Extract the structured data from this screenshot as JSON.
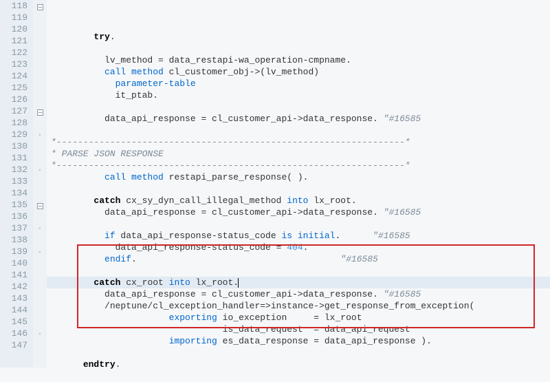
{
  "lines": [
    {
      "num": 118,
      "fold": "minus",
      "tokens": [
        [
          "sp",
          "        "
        ],
        [
          "kwbold",
          "try"
        ],
        [
          "ident",
          "."
        ]
      ]
    },
    {
      "num": 119,
      "tokens": []
    },
    {
      "num": 120,
      "tokens": [
        [
          "sp",
          "          "
        ],
        [
          "ident",
          "lv_method = data_restapi-wa_operation-cmpname."
        ]
      ]
    },
    {
      "num": 121,
      "tokens": [
        [
          "sp",
          "          "
        ],
        [
          "kw",
          "call method"
        ],
        [
          "ident",
          " cl_customer_obj->(lv_method)"
        ]
      ]
    },
    {
      "num": 122,
      "tokens": [
        [
          "sp",
          "            "
        ],
        [
          "kw",
          "parameter-table"
        ]
      ]
    },
    {
      "num": 123,
      "tokens": [
        [
          "sp",
          "            "
        ],
        [
          "ident",
          "it_ptab."
        ]
      ]
    },
    {
      "num": 124,
      "tokens": []
    },
    {
      "num": 125,
      "tokens": [
        [
          "sp",
          "          "
        ],
        [
          "ident",
          "data_api_response = cl_customer_api->data_response. "
        ],
        [
          "comment",
          "\"#16585"
        ]
      ]
    },
    {
      "num": 126,
      "tokens": []
    },
    {
      "num": 127,
      "fold": "minus",
      "tokens": [
        [
          "comment",
          "*-----------------------------------------------------------------*"
        ]
      ]
    },
    {
      "num": 128,
      "tokens": [
        [
          "comment",
          "* PARSE JSON RESPONSE"
        ]
      ]
    },
    {
      "num": 129,
      "fold": "end",
      "tokens": [
        [
          "comment",
          "*-----------------------------------------------------------------*"
        ]
      ]
    },
    {
      "num": 130,
      "tokens": [
        [
          "sp",
          "          "
        ],
        [
          "kw",
          "call method"
        ],
        [
          "ident",
          " restapi_parse_response( )."
        ]
      ]
    },
    {
      "num": 131,
      "tokens": []
    },
    {
      "num": 132,
      "fold": "end",
      "tokens": [
        [
          "sp",
          "        "
        ],
        [
          "kwbold",
          "catch"
        ],
        [
          "ident",
          " cx_sy_dyn_call_illegal_method "
        ],
        [
          "kw",
          "into"
        ],
        [
          "ident",
          " lx_root."
        ]
      ]
    },
    {
      "num": 133,
      "tokens": [
        [
          "sp",
          "          "
        ],
        [
          "ident",
          "data_api_response = cl_customer_api->data_response. "
        ],
        [
          "comment",
          "\"#16585"
        ]
      ]
    },
    {
      "num": 134,
      "tokens": []
    },
    {
      "num": 135,
      "fold": "minus",
      "tokens": [
        [
          "sp",
          "          "
        ],
        [
          "kw",
          "if"
        ],
        [
          "ident",
          " data_api_response-status_code "
        ],
        [
          "kw",
          "is initial"
        ],
        [
          "ident",
          "."
        ],
        [
          "sp",
          "      "
        ],
        [
          "comment",
          "\"#16585"
        ]
      ]
    },
    {
      "num": 136,
      "tokens": [
        [
          "sp",
          "            "
        ],
        [
          "ident",
          "data_api_response-status_code = "
        ],
        [
          "num",
          "404"
        ],
        [
          "ident",
          "."
        ]
      ]
    },
    {
      "num": 137,
      "fold": "end",
      "tokens": [
        [
          "sp",
          "          "
        ],
        [
          "kw",
          "endif"
        ],
        [
          "ident",
          "."
        ],
        [
          "sp",
          "                                      "
        ],
        [
          "comment",
          "\"#16585"
        ]
      ]
    },
    {
      "num": 138,
      "tokens": []
    },
    {
      "num": 139,
      "fold": "end",
      "current": true,
      "caret": true,
      "tokens": [
        [
          "sp",
          "        "
        ],
        [
          "kwbold",
          "catch"
        ],
        [
          "ident",
          " cx_root "
        ],
        [
          "kw",
          "into"
        ],
        [
          "ident",
          " lx_root."
        ]
      ]
    },
    {
      "num": 140,
      "tokens": [
        [
          "sp",
          "          "
        ],
        [
          "ident",
          "data_api_response = cl_customer_api->data_response. "
        ],
        [
          "comment",
          "\"#16585"
        ]
      ]
    },
    {
      "num": 141,
      "tokens": [
        [
          "sp",
          "          "
        ],
        [
          "ident",
          "/neptune/cl_exception_handler=>instance->get_response_from_exception("
        ]
      ]
    },
    {
      "num": 142,
      "tokens": [
        [
          "sp",
          "                      "
        ],
        [
          "kw",
          "exporting"
        ],
        [
          "ident",
          " io_exception     = lx_root"
        ]
      ]
    },
    {
      "num": 143,
      "tokens": [
        [
          "sp",
          "                                "
        ],
        [
          "ident",
          "is_data_request  = data_api_request"
        ]
      ]
    },
    {
      "num": 144,
      "tokens": [
        [
          "sp",
          "                      "
        ],
        [
          "kw",
          "importing"
        ],
        [
          "ident",
          " es_data_response = data_api_response )."
        ]
      ]
    },
    {
      "num": 145,
      "tokens": []
    },
    {
      "num": 146,
      "fold": "end",
      "tokens": [
        [
          "sp",
          "      "
        ],
        [
          "kwbold",
          "endtry"
        ],
        [
          "ident",
          "."
        ]
      ]
    },
    {
      "num": 147,
      "tokens": []
    }
  ],
  "highlight_box": {
    "top_line": 139,
    "bottom_line": 145
  }
}
